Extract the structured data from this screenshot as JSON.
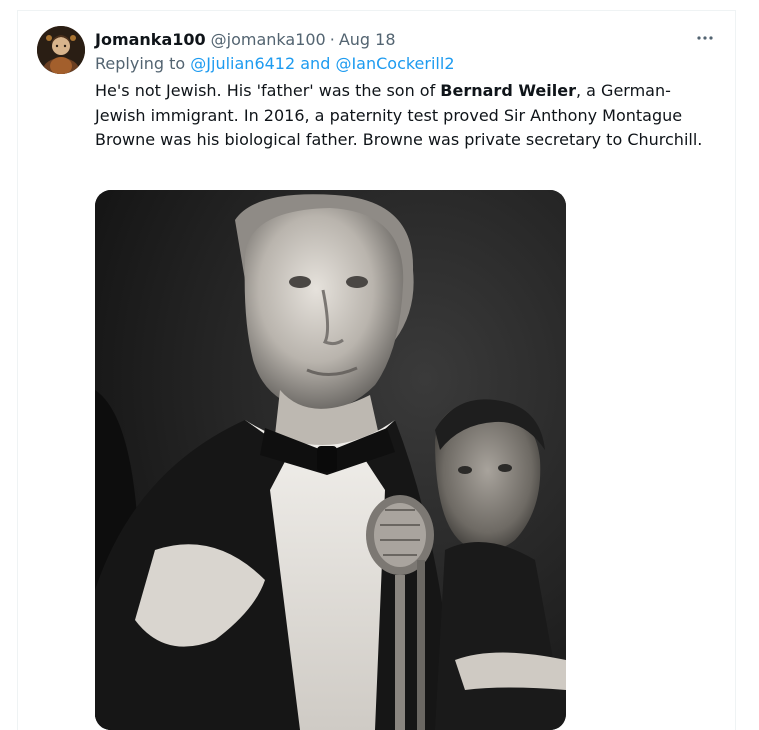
{
  "tweet": {
    "author": {
      "display_name": "Jomanka100",
      "handle": "@jomanka100",
      "separator": "·",
      "date": "Aug 18"
    },
    "more_icon": "more-horizontal-icon",
    "replying": {
      "prefix": "Replying to ",
      "mention_1": "@Jjulian6412",
      "conjunction": " and ",
      "mention_2": "@IanCockerill2"
    },
    "body": {
      "part_1": "He's not Jewish.  His 'father' was the son of ",
      "bold_name": "Bernard Weiler",
      "part_2": ", a German-Jewish immigrant.  In 2016, a paternity test proved Sir Anthony Montague Browne was his biological father.  Browne was private secretary to Churchill."
    },
    "colors": {
      "text": "#0f1419",
      "secondary": "#536471",
      "link": "#1d9bf0"
    }
  }
}
